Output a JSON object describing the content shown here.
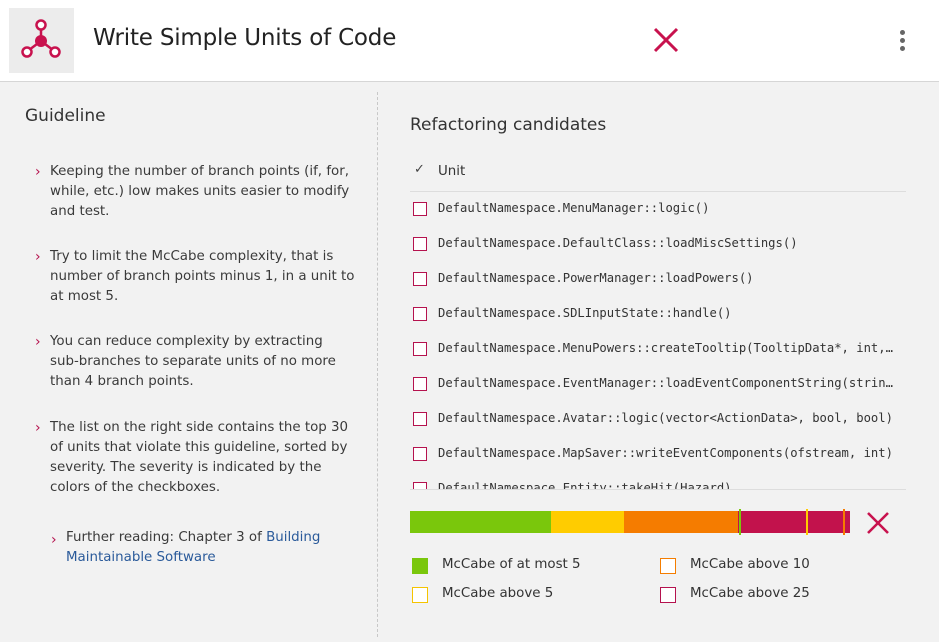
{
  "header": {
    "title": "Write Simple Units of Code"
  },
  "guideline": {
    "heading": "Guideline",
    "items": [
      "Keeping the number of branch points (if, for, while, etc.) low makes units easier to modify and test.",
      "Try to limit the McCabe complexity, that is number of branch points minus 1, in a unit to at most 5.",
      "You can reduce complexity by extracting sub-branches to separate units of no more than 4 branch points.",
      "The list on the right side contains the top 30 of units that violate this guideline, sorted by severity. The severity is indicated by the colors of the checkboxes."
    ],
    "further_prefix": "Further reading: Chapter 3 of ",
    "further_link": "Building Maintainable Software"
  },
  "refactoring": {
    "heading": "Refactoring candidates",
    "column_label": "Unit",
    "units": [
      "DefaultNamespace.MenuManager::logic()",
      "DefaultNamespace.DefaultClass::loadMiscSettings()",
      "DefaultNamespace.PowerManager::loadPowers()",
      "DefaultNamespace.SDLInputState::handle()",
      "DefaultNamespace.MenuPowers::createTooltip(TooltipData*, int, int, bool)",
      "DefaultNamespace.EventManager::loadEventComponentString(string&)",
      "DefaultNamespace.Avatar::logic(vector<ActionData>, bool, bool)",
      "DefaultNamespace.MapSaver::writeEventComponents(ofstream, int)",
      "DefaultNamespace.Entity::takeHit(Hazard)"
    ]
  },
  "severity": {
    "bar_fractions": {
      "green": 0.32,
      "yellow": 0.165,
      "orange": 0.26,
      "red": 0.255
    },
    "legend": [
      {
        "label": "McCabe of at most 5",
        "color": "#7ac70c",
        "filled": true
      },
      {
        "label": "McCabe above 5",
        "color": "#f5c400",
        "filled": false
      },
      {
        "label": "McCabe above 10",
        "color": "#f47d00",
        "filled": false
      },
      {
        "label": "McCabe above 25",
        "color": "#b5124e",
        "filled": false
      }
    ]
  },
  "colors": {
    "accent": "#c8124e",
    "green": "#7ac70c",
    "yellow": "#ffcc00",
    "orange": "#f57c00",
    "red": "#c2124c"
  }
}
